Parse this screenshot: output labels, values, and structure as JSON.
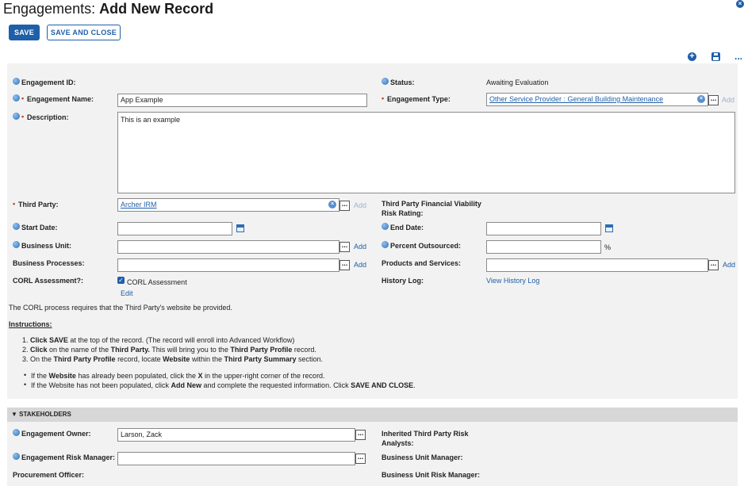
{
  "header": {
    "title_prefix": "Engagements:",
    "title_main": "Add New Record",
    "close_icon": "close-icon"
  },
  "toolbar": {
    "save_label": "SAVE",
    "save_close_label": "SAVE AND CLOSE",
    "icons": [
      "add-circle-icon",
      "save-disk-icon",
      "more-icon"
    ],
    "more_glyph": "..."
  },
  "form": {
    "engagement_id_label": "Engagement ID:",
    "status_label": "Status:",
    "status_value": "Awaiting Evaluation",
    "engagement_name_label": "Engagement Name:",
    "engagement_name_value": "App Example",
    "engagement_type_label": "Engagement Type:",
    "engagement_type_value": "Other Service Provider : General Building Maintenance",
    "description_label": "Description:",
    "description_value": "This is an example",
    "third_party_label": "Third Party:",
    "third_party_value": "Archer IRM",
    "tpfv_label_line1": "Third Party Financial Viability",
    "tpfv_label_line2": "Risk Rating:",
    "start_date_label": "Start Date:",
    "end_date_label": "End Date:",
    "business_unit_label": "Business Unit:",
    "percent_outsourced_label": "Percent Outsourced:",
    "percent_symbol": "%",
    "business_processes_label": "Business Processes:",
    "products_services_label": "Products and Services:",
    "corl_label": "CORL Assessment?:",
    "corl_checkbox_label": "CORL Assessment",
    "corl_checked": true,
    "edit_link": "Edit",
    "history_log_label": "History Log:",
    "history_log_link": "View History Log",
    "add_label": "Add",
    "dots_glyph": "...",
    "required_glyph": "•",
    "clear_glyph": "×",
    "check_glyph": "✓"
  },
  "instructions": {
    "note": "The CORL process requires that the Third Party's website be provided.",
    "heading": "Instructions:",
    "step1_a": "1. ",
    "step1_b": "Click SAVE",
    "step1_c": " at the top of the record. (The record will enroll into Advanced Workflow)",
    "step2_a": "2. ",
    "step2_b": "Click",
    "step2_c": " on the name of the ",
    "step2_d": "Third Party.",
    "step2_e": " This will bring you to the ",
    "step2_f": "Third Party Profile",
    "step2_g": " record.",
    "step3_a": "3. On the ",
    "step3_b": "Third Party Profile",
    "step3_c": " record, locate ",
    "step3_d": "Website",
    "step3_e": " within the ",
    "step3_f": "Third Party Summary",
    "step3_g": " section.",
    "bullet1_a": "If the ",
    "bullet1_b": "Website",
    "bullet1_c": " has already been populated, click the ",
    "bullet1_d": "X",
    "bullet1_e": " in the upper-right corner of the record.",
    "bullet2_a": "If the Website has not been populated, click ",
    "bullet2_b": "Add New",
    "bullet2_c": " and complete the requested information. Click ",
    "bullet2_d": "SAVE AND CLOSE",
    "bullet2_e": ".",
    "bullet_glyph": "•"
  },
  "stakeholders": {
    "section_title": "STAKEHOLDERS",
    "toggle_glyph": "▼",
    "engagement_owner_label": "Engagement Owner:",
    "engagement_owner_value": "Larson, Zack",
    "inherited_label_line1": "Inherited Third Party Risk",
    "inherited_label_line2": "Analysts:",
    "risk_manager_label": "Engagement Risk Manager:",
    "bu_manager_label": "Business Unit Manager:",
    "procurement_label": "Procurement Officer:",
    "bu_risk_manager_label": "Business Unit Risk Manager:"
  }
}
